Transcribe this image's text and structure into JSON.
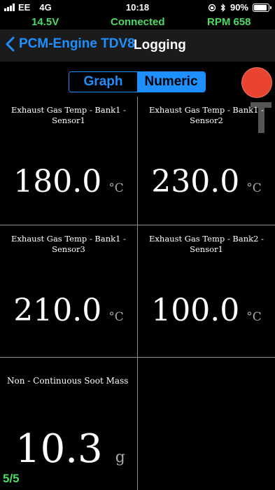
{
  "status_bar": {
    "carrier": "EE",
    "network": "4G",
    "time": "10:18",
    "battery": "90%"
  },
  "vehicle_status": {
    "voltage": "14.5V",
    "connection": "Connected",
    "rpm": "RPM 658",
    "color": "#4cd964"
  },
  "nav": {
    "back_label": "PCM-Engine TDV8",
    "title": "Logging",
    "accent": "#1e8ffe"
  },
  "view_toggle": {
    "options": [
      "Graph",
      "Numeric"
    ],
    "selected": "Numeric"
  },
  "record_color": "#e94430",
  "cells": [
    {
      "label": "Exhaust Gas Temp - Bank1 - Sensor1",
      "value": "180.0",
      "unit": "°C"
    },
    {
      "label": "Exhaust Gas Temp - Bank1 - Sensor2",
      "value": "230.0",
      "unit": "°C"
    },
    {
      "label": "Exhaust Gas Temp - Bank1 - Sensor3",
      "value": "210.0",
      "unit": "°C"
    },
    {
      "label": "Exhaust Gas Temp - Bank2 - Sensor1",
      "value": "100.0",
      "unit": "°C"
    },
    {
      "label": "Non - Continuous Soot Mass",
      "value": "10.3",
      "unit": "g"
    }
  ],
  "page_indicator": "5/5"
}
